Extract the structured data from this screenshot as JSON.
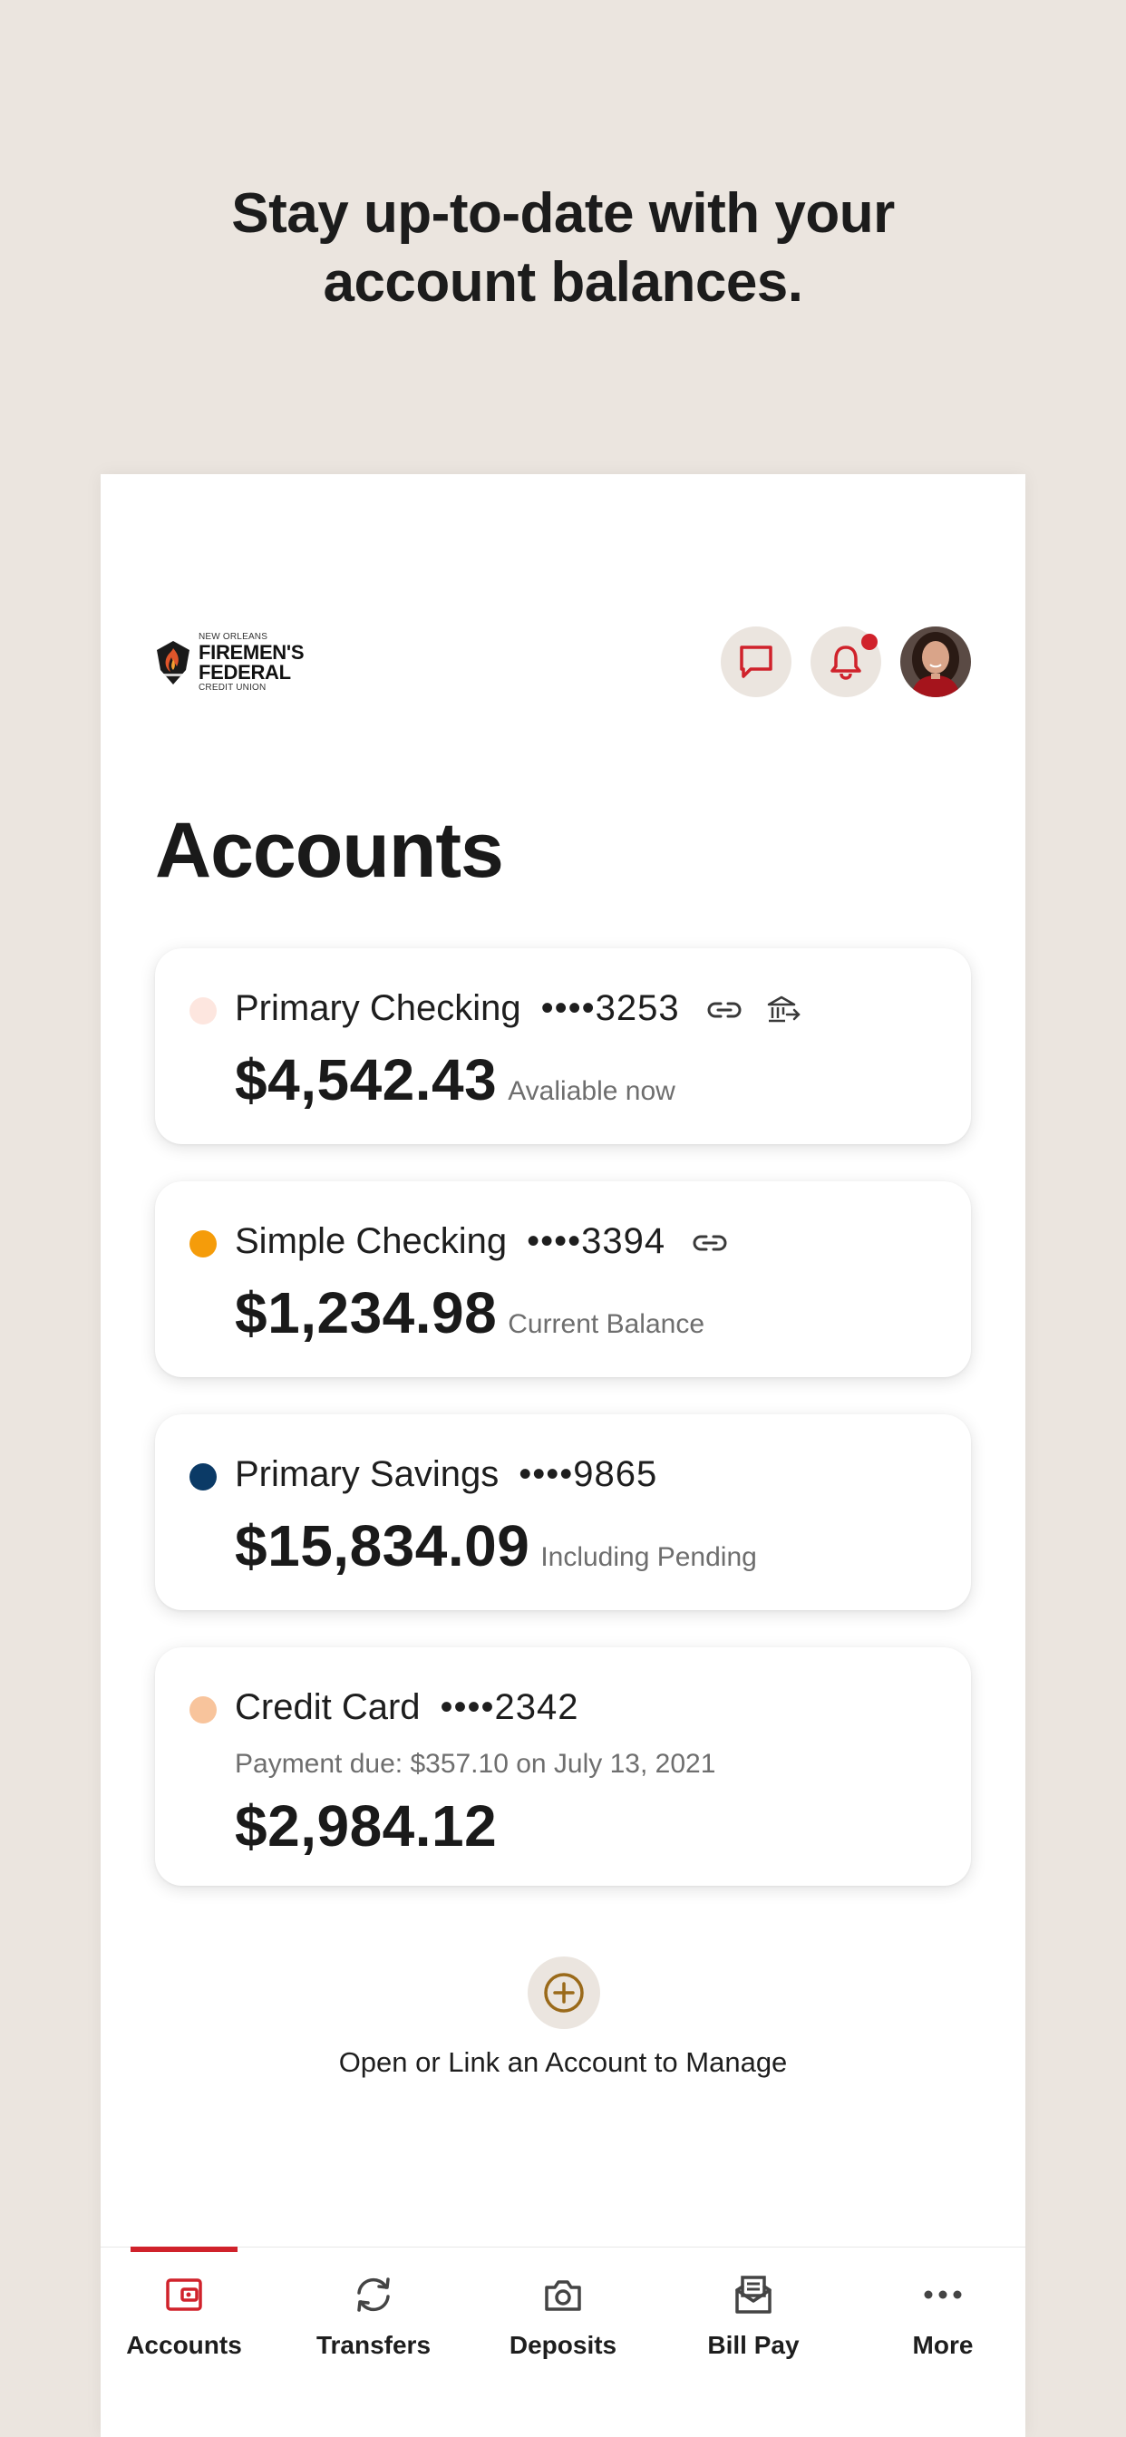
{
  "headline": {
    "line1": "Stay up-to-date with your",
    "line2": "account balances."
  },
  "header": {
    "logo": {
      "small_top": "NEW ORLEANS",
      "name": "FIREMEN'S FEDERAL",
      "small_bottom": "CREDIT UNION"
    },
    "chat_icon": "chat-bubble-icon",
    "bell_icon": "bell-icon",
    "has_notification": true
  },
  "page_title": "Accounts",
  "accounts": [
    {
      "name": "Primary Checking",
      "mask": "••••3253",
      "balance": "$4,542.43",
      "note": "Avaliable now",
      "dot_color": "#fde6df",
      "icons": [
        "link-icon",
        "bank-transfer-icon"
      ]
    },
    {
      "name": "Simple Checking",
      "mask": "••••3394",
      "balance": "$1,234.98",
      "note": "Current Balance",
      "dot_color": "#f59c0a",
      "icons": [
        "link-icon"
      ]
    },
    {
      "name": "Primary Savings",
      "mask": "••••9865",
      "balance": "$15,834.09",
      "note": "Including Pending",
      "dot_color": "#0b3a66",
      "icons": []
    },
    {
      "name": "Credit Card",
      "mask": "••••2342",
      "due": "Payment due: $357.10 on July 13, 2021",
      "balance": "$2,984.12",
      "dot_color": "#f8c49c",
      "icons": []
    }
  ],
  "add_account": {
    "icon": "plus-circle-icon",
    "label": "Open or Link an Account to Manage"
  },
  "tabs": [
    {
      "label": "Accounts",
      "icon": "wallet-icon",
      "active": true
    },
    {
      "label": "Transfers",
      "icon": "refresh-arrows-icon",
      "active": false
    },
    {
      "label": "Deposits",
      "icon": "camera-icon",
      "active": false
    },
    {
      "label": "Bill Pay",
      "icon": "envelope-tray-icon",
      "active": false
    },
    {
      "label": "More",
      "icon": "more-dots-icon",
      "active": false
    }
  ],
  "colors": {
    "background": "#ebe5df",
    "accent_red": "#d0222b",
    "add_gold": "#9a6a1a"
  }
}
